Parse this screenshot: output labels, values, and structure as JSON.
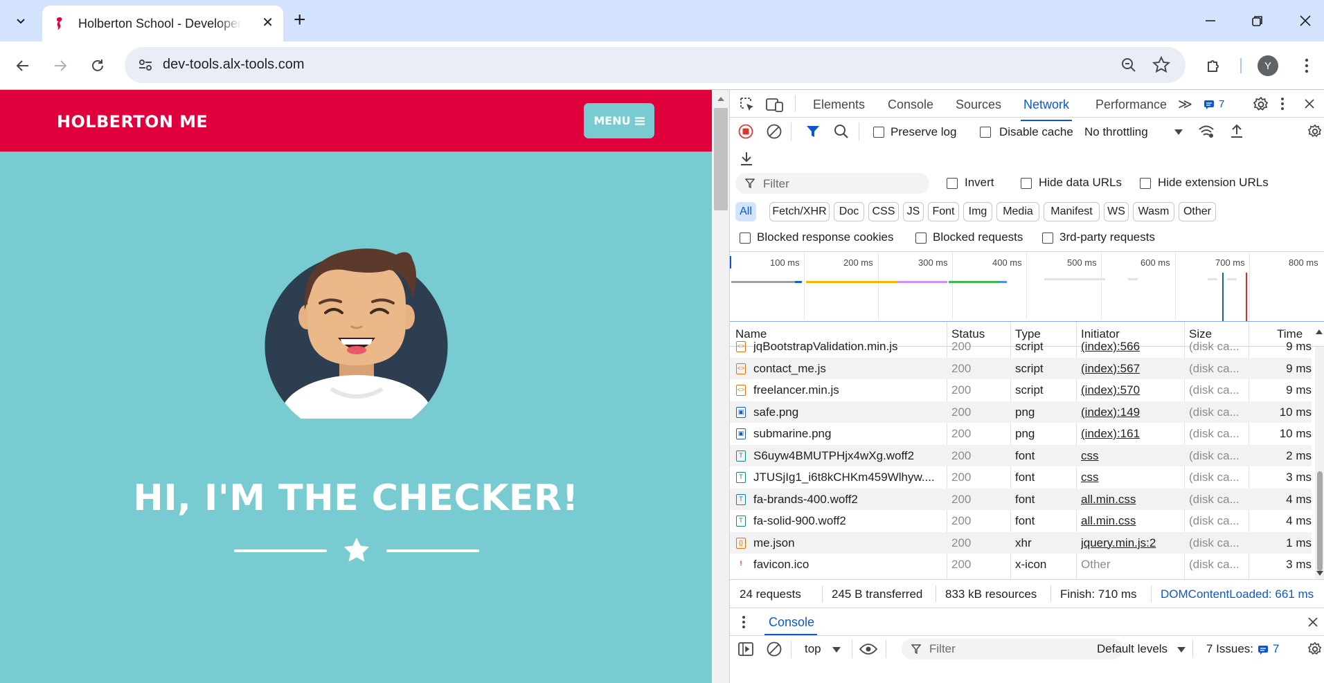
{
  "browser": {
    "tab_title": "Holberton School - Developer tools",
    "url": "dev-tools.alx-tools.com",
    "profile_initial": "Y"
  },
  "page": {
    "brand": "HOLBERTON ME",
    "menu_label": "MENU",
    "hero_title": "HI, I'M THE CHECKER!"
  },
  "devtools": {
    "tabs": [
      "Elements",
      "Console",
      "Sources",
      "Network",
      "Performance"
    ],
    "active_tab": "Network",
    "issues_count": "7",
    "toolbar": {
      "preserve_log": "Preserve log",
      "disable_cache": "Disable cache",
      "throttling": "No throttling"
    },
    "filter": {
      "placeholder": "Filter",
      "invert": "Invert",
      "hide_data_urls": "Hide data URLs",
      "hide_extension_urls": "Hide extension URLs"
    },
    "type_filters": [
      "All",
      "Fetch/XHR",
      "Doc",
      "CSS",
      "JS",
      "Font",
      "Img",
      "Media",
      "Manifest",
      "WS",
      "Wasm",
      "Other"
    ],
    "blocked": {
      "blocked_response_cookies": "Blocked response cookies",
      "blocked_requests": "Blocked requests",
      "third_party_requests": "3rd-party requests"
    },
    "timeline_ticks": [
      "100 ms",
      "200 ms",
      "300 ms",
      "400 ms",
      "500 ms",
      "600 ms",
      "700 ms",
      "800 ms"
    ],
    "columns": [
      "Name",
      "Status",
      "Type",
      "Initiator",
      "Size",
      "Time"
    ],
    "rows": [
      {
        "name": "jqBootstrapValidation.min.js",
        "status": "200",
        "type": "script",
        "initiator": "(index):566",
        "size": "(disk ca...",
        "time": "9 ms",
        "kind": "script"
      },
      {
        "name": "contact_me.js",
        "status": "200",
        "type": "script",
        "initiator": "(index):567",
        "size": "(disk ca...",
        "time": "9 ms",
        "kind": "script"
      },
      {
        "name": "freelancer.min.js",
        "status": "200",
        "type": "script",
        "initiator": "(index):570",
        "size": "(disk ca...",
        "time": "9 ms",
        "kind": "script"
      },
      {
        "name": "safe.png",
        "status": "200",
        "type": "png",
        "initiator": "(index):149",
        "size": "(disk ca...",
        "time": "10 ms",
        "kind": "image"
      },
      {
        "name": "submarine.png",
        "status": "200",
        "type": "png",
        "initiator": "(index):161",
        "size": "(disk ca...",
        "time": "10 ms",
        "kind": "image"
      },
      {
        "name": "S6uyw4BMUTPHjx4wXg.woff2",
        "status": "200",
        "type": "font",
        "initiator": "css",
        "size": "(disk ca...",
        "time": "2 ms",
        "kind": "font"
      },
      {
        "name": "JTUSjIg1_i6t8kCHKm459Wlhyw....",
        "status": "200",
        "type": "font",
        "initiator": "css",
        "size": "(disk ca...",
        "time": "3 ms",
        "kind": "font"
      },
      {
        "name": "fa-brands-400.woff2",
        "status": "200",
        "type": "font",
        "initiator": "all.min.css",
        "size": "(disk ca...",
        "time": "4 ms",
        "kind": "font"
      },
      {
        "name": "fa-solid-900.woff2",
        "status": "200",
        "type": "font",
        "initiator": "all.min.css",
        "size": "(disk ca...",
        "time": "4 ms",
        "kind": "font"
      },
      {
        "name": "me.json",
        "status": "200",
        "type": "xhr",
        "initiator": "jquery.min.js:2",
        "size": "(disk ca...",
        "time": "1 ms",
        "kind": "xhr"
      },
      {
        "name": "favicon.ico",
        "status": "200",
        "type": "x-icon",
        "initiator": "Other",
        "size": "(disk ca...",
        "time": "3 ms",
        "kind": "favicon"
      }
    ],
    "summary": {
      "requests": "24 requests",
      "transferred": "245 B transferred",
      "resources": "833 kB resources",
      "finish": "Finish: 710 ms",
      "dom_content_loaded": "DOMContentLoaded: 661 ms"
    },
    "drawer": {
      "tab": "Console",
      "context": "top",
      "filter_placeholder": "Filter",
      "levels": "Default levels",
      "issues": "7 Issues:",
      "issues_count": "7"
    }
  },
  "colors": {
    "brand_red": "#e0003c",
    "page_teal": "#78cbd0",
    "devtools_blue": "#0b57d0"
  }
}
